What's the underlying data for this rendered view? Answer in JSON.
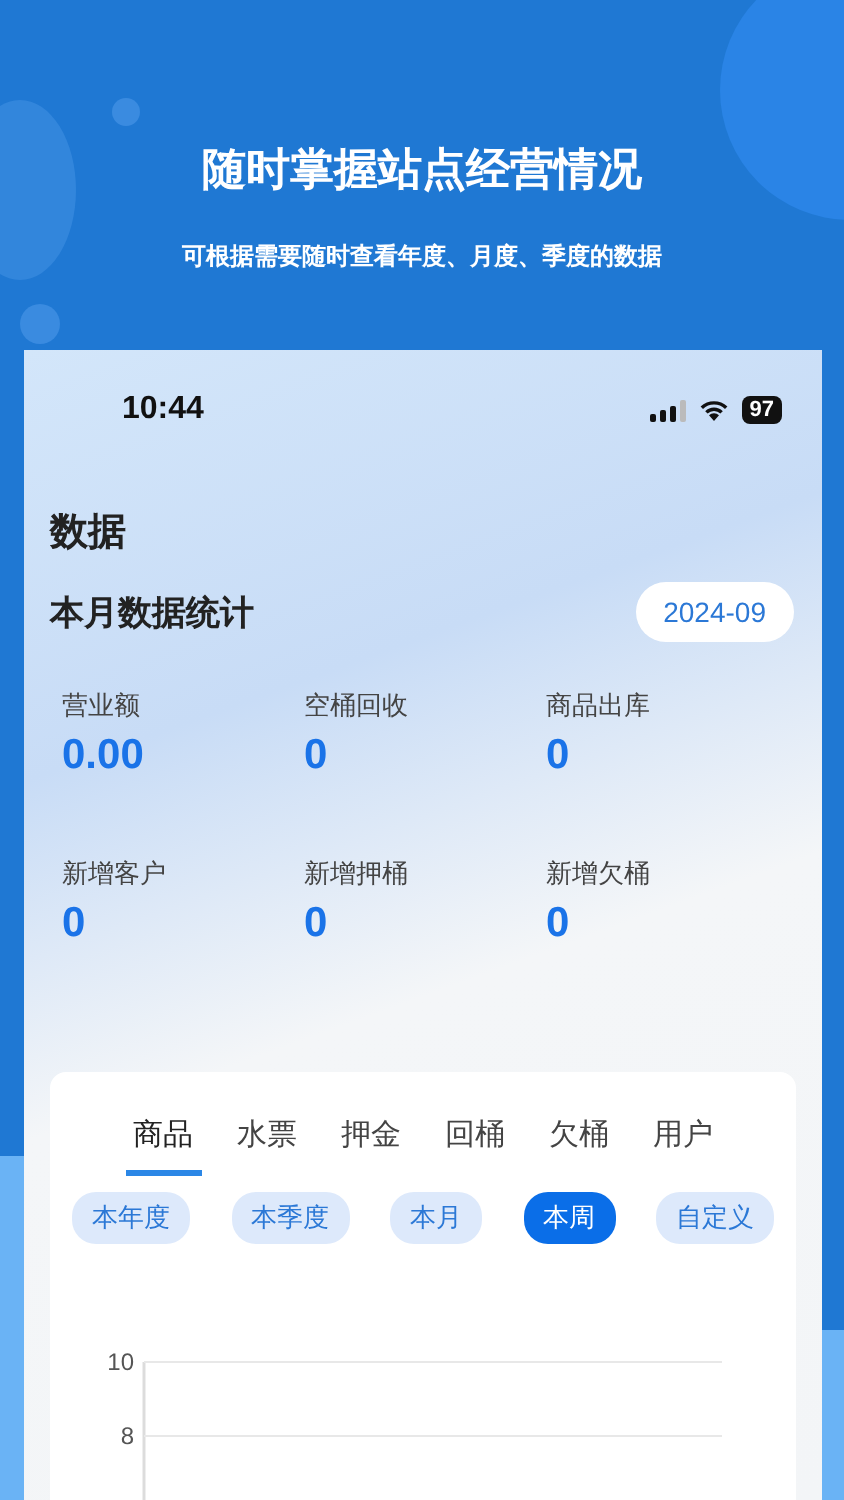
{
  "banner": {
    "title": "随时掌握站点经营情况",
    "subtitle": "可根据需要随时查看年度、月度、季度的数据"
  },
  "status_bar": {
    "time": "10:44",
    "battery": "97"
  },
  "page_title": "数据",
  "monthly": {
    "title": "本月数据统计",
    "month": "2024-09",
    "stats": [
      {
        "label": "营业额",
        "value": "0.00"
      },
      {
        "label": "空桶回收",
        "value": "0"
      },
      {
        "label": "商品出库",
        "value": "0"
      },
      {
        "label": "新增客户",
        "value": "0"
      },
      {
        "label": "新增押桶",
        "value": "0"
      },
      {
        "label": "新增欠桶",
        "value": "0"
      }
    ]
  },
  "tabs": [
    {
      "label": "商品",
      "selected": true
    },
    {
      "label": "水票",
      "selected": false
    },
    {
      "label": "押金",
      "selected": false
    },
    {
      "label": "回桶",
      "selected": false
    },
    {
      "label": "欠桶",
      "selected": false
    },
    {
      "label": "用户",
      "selected": false
    }
  ],
  "periods": [
    {
      "label": "本年度",
      "selected": false
    },
    {
      "label": "本季度",
      "selected": false
    },
    {
      "label": "本月",
      "selected": false
    },
    {
      "label": "本周",
      "selected": true
    },
    {
      "label": "自定义",
      "selected": false
    }
  ],
  "chart": {
    "axis_labels": [
      "10",
      "8"
    ]
  }
}
